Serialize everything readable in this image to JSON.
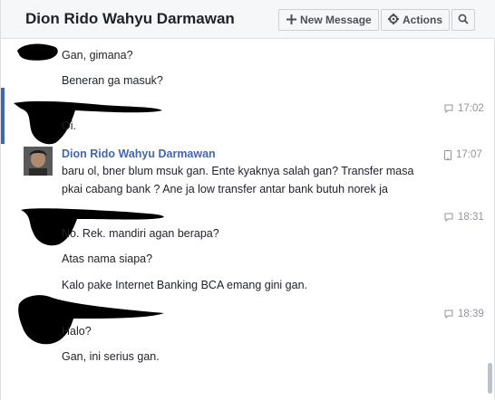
{
  "header": {
    "title": "Dion Rido Wahyu Darmawan",
    "new_message_label": "New Message",
    "actions_label": "Actions"
  },
  "messages": {
    "m1": "Gan, gimana?",
    "m2": "Beneran ga masuk?",
    "m3": "Oi.",
    "m4_sender": "Dion Rido Wahyu Darmawan",
    "m4": "baru ol, bner blum msuk gan. Ente kyaknya salah gan? Transfer masa pkai cabang bank ? Ane ja low transfer antar bank butuh norek ja",
    "m5": "No. Rek. mandiri agan berapa?",
    "m6": "Atas nama siapa?",
    "m7": "Kalo pake Internet Banking BCA emang gini gan.",
    "m8": "Halo?",
    "m9": "Gan, ini serius gan."
  },
  "times": {
    "t1": "17:02",
    "t2": "17:07",
    "t3": "18:31",
    "t4": "18:39"
  },
  "icons": {
    "chat": "chat-bubble-icon",
    "mobile": "mobile-phone-icon",
    "plus": "plus-icon",
    "gear": "gear-icon",
    "search": "search-icon"
  }
}
